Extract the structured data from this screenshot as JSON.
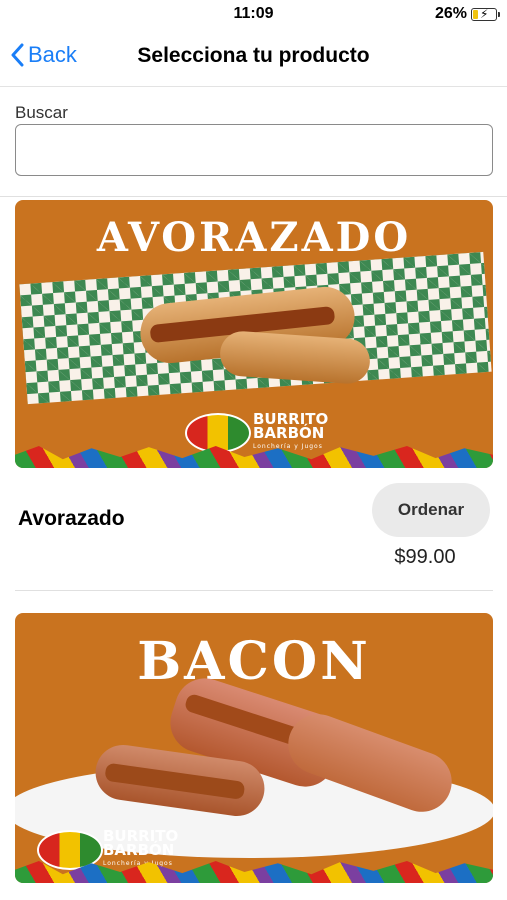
{
  "status_bar": {
    "time": "11:09",
    "battery_percent": "26%",
    "battery_level": 0.26
  },
  "nav": {
    "back_label": "Back",
    "title": "Selecciona tu producto"
  },
  "search": {
    "label": "Buscar",
    "value": "",
    "placeholder": ""
  },
  "products": [
    {
      "name": "Avorazado",
      "price": "$99.00",
      "order_label": "Ordenar",
      "image": {
        "banner_text": "AVORAZADO",
        "brand_line1": "BURRITO",
        "brand_line2": "BARBÓN",
        "brand_tagline": "Lonchería y Jugos"
      }
    },
    {
      "name": "",
      "price": "",
      "order_label": "",
      "image": {
        "banner_text": "BACON",
        "brand_line1": "BURRITO",
        "brand_line2": "BARBÓN",
        "brand_tagline": "Lonchería y Jugos"
      }
    }
  ],
  "colors": {
    "accent": "#1a7ef7",
    "card_background": "#c9731f",
    "button_background": "#eaeaea"
  }
}
